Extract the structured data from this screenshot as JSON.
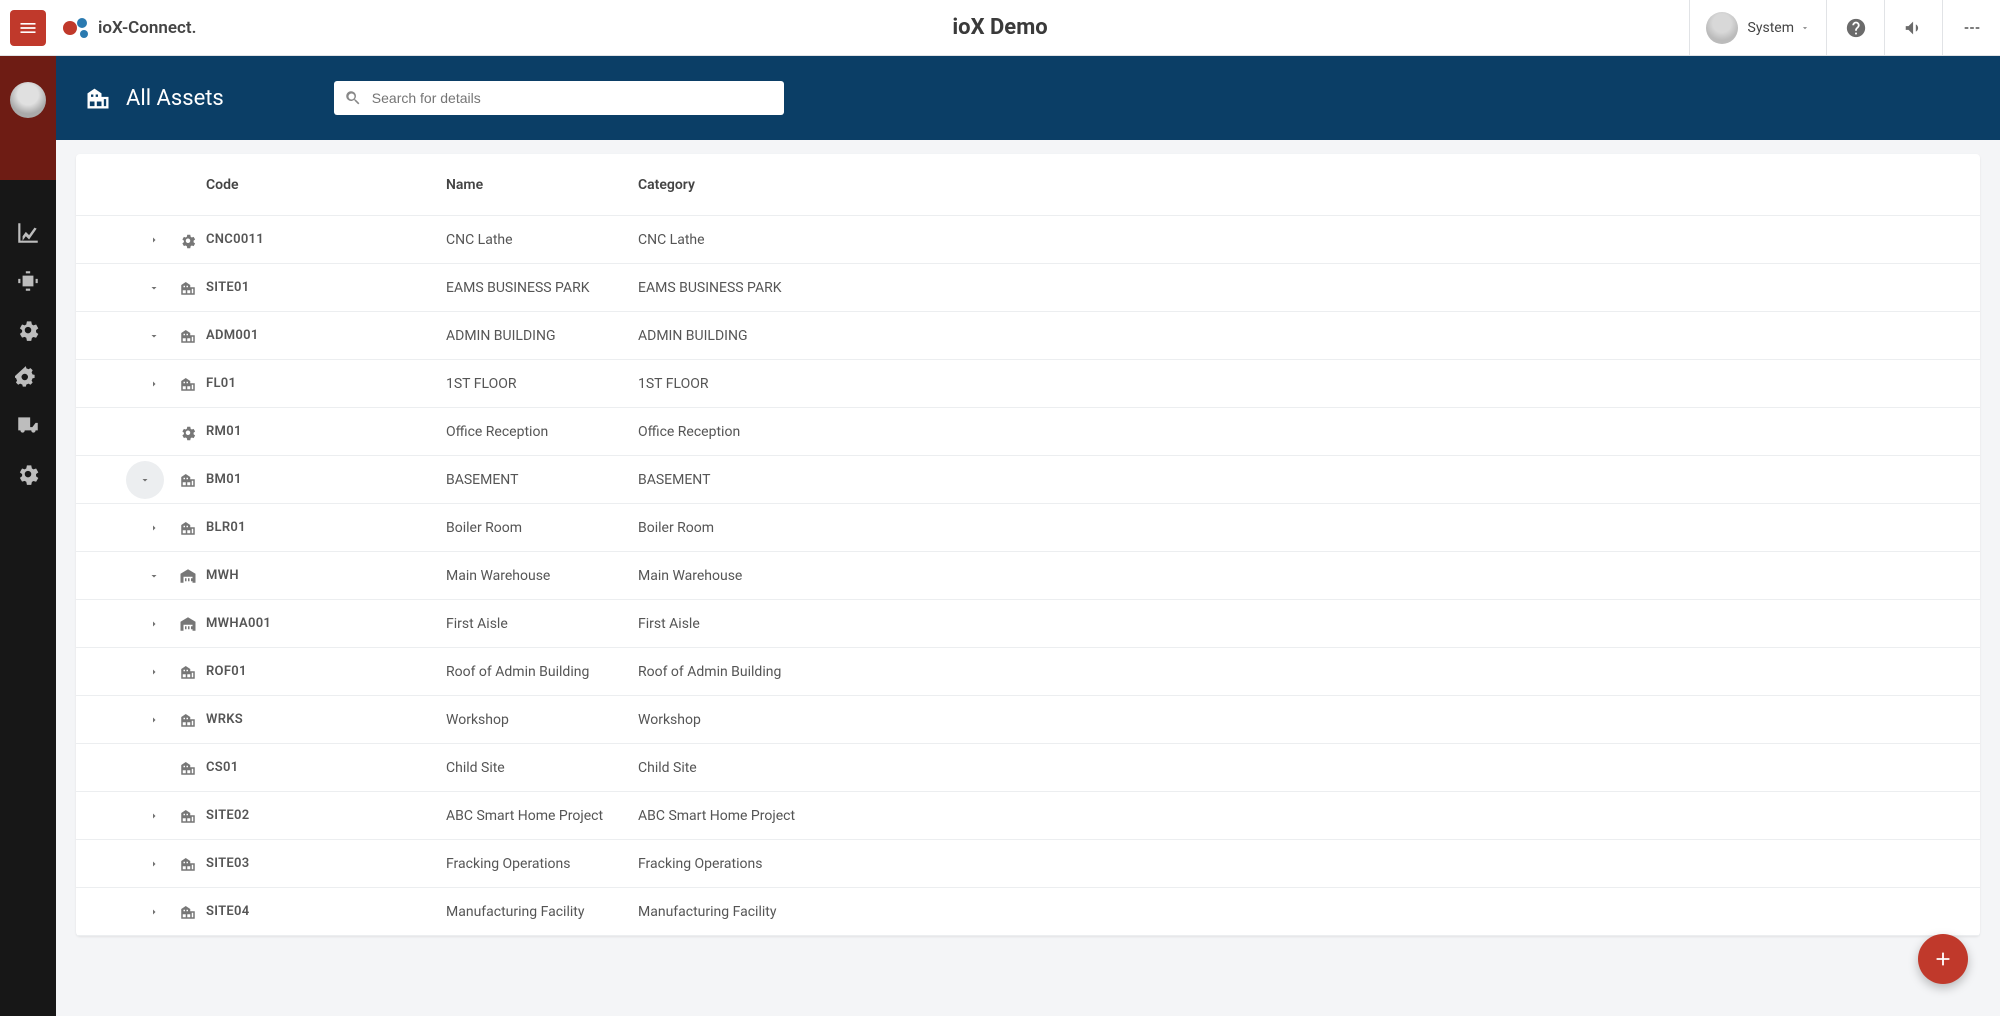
{
  "header": {
    "logo_text": "ioX-Connect.",
    "app_title": "ioX Demo",
    "user_name": "System"
  },
  "page": {
    "title": "All Assets",
    "search_placeholder": "Search for details"
  },
  "columns": {
    "code": "Code",
    "name": "Name",
    "category": "Category"
  },
  "rows": [
    {
      "code": "CNC0011",
      "name": "CNC Lathe",
      "category": "CNC Lathe",
      "icon": "gear",
      "indent": 0,
      "expander": "right"
    },
    {
      "code": "SITE01",
      "name": "EAMS BUSINESS PARK",
      "category": "EAMS BUSINESS PARK",
      "icon": "building",
      "indent": 0,
      "expander": "down"
    },
    {
      "code": "ADM001",
      "name": "ADMIN BUILDING",
      "category": "ADMIN BUILDING",
      "icon": "building",
      "indent": 1,
      "expander": "down"
    },
    {
      "code": "FL01",
      "name": "1ST FLOOR",
      "category": "1ST FLOOR",
      "icon": "building",
      "indent": 2,
      "expander": "right"
    },
    {
      "code": "RM01",
      "name": "Office Reception",
      "category": "Office Reception",
      "icon": "gear",
      "indent": 2,
      "expander": "none"
    },
    {
      "code": "BM01",
      "name": "BASEMENT",
      "category": "BASEMENT",
      "icon": "building",
      "indent": 2,
      "expander": "down-circle"
    },
    {
      "code": "BLR01",
      "name": "Boiler Room",
      "category": "Boiler Room",
      "icon": "building",
      "indent": 3,
      "expander": "right"
    },
    {
      "code": "MWH",
      "name": "Main Warehouse",
      "category": "Main Warehouse",
      "icon": "warehouse",
      "indent": 2,
      "expander": "down"
    },
    {
      "code": "MWHA001",
      "name": "First Aisle",
      "category": "First Aisle",
      "icon": "warehouse",
      "indent": 3,
      "expander": "right"
    },
    {
      "code": "ROF01",
      "name": "Roof of Admin Building",
      "category": "Roof of Admin Building",
      "icon": "building",
      "indent": 2,
      "expander": "right"
    },
    {
      "code": "WRKS",
      "name": "Workshop",
      "category": "Workshop",
      "icon": "building",
      "indent": 1,
      "expander": "right"
    },
    {
      "code": "CS01",
      "name": "Child Site",
      "category": "Child Site",
      "icon": "building",
      "indent": 1,
      "expander": "none"
    },
    {
      "code": "SITE02",
      "name": "ABC Smart Home Project",
      "category": "ABC Smart Home Project",
      "icon": "building",
      "indent": 0,
      "expander": "right"
    },
    {
      "code": "SITE03",
      "name": "Fracking Operations",
      "category": "Fracking Operations",
      "icon": "building",
      "indent": 0,
      "expander": "right"
    },
    {
      "code": "SITE04",
      "name": "Manufacturing Facility",
      "category": "Manufacturing Facility",
      "icon": "building",
      "indent": 0,
      "expander": "right"
    }
  ]
}
